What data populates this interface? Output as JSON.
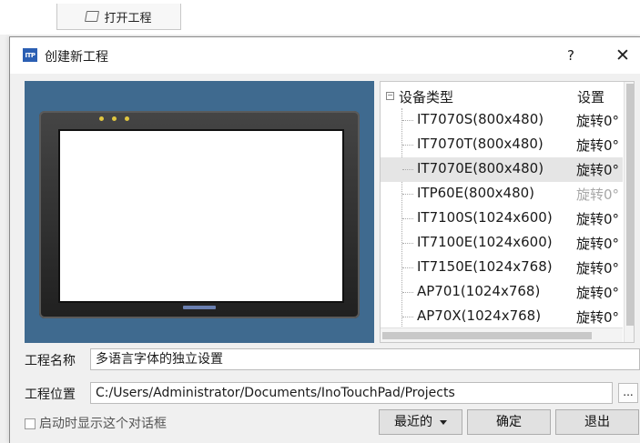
{
  "background_window": {
    "open_project_label": "打开工程"
  },
  "dialog": {
    "title": "创建新工程",
    "icon_text": "ITP",
    "help_label": "?",
    "close_label": "✕"
  },
  "device_table": {
    "header_type": "设备类型",
    "header_setting": "设置",
    "rows": [
      {
        "name": "IT7070S(800x480)",
        "setting": "旋转0°"
      },
      {
        "name": "IT7070T(800x480)",
        "setting": "旋转0°"
      },
      {
        "name": "IT7070E(800x480)",
        "setting": "旋转0°"
      },
      {
        "name": "ITP60E(800x480)",
        "setting": "旋转0°"
      },
      {
        "name": "IT7100S(1024x600)",
        "setting": "旋转0°"
      },
      {
        "name": "IT7100E(1024x600)",
        "setting": "旋转0°"
      },
      {
        "name": "IT7150E(1024x768)",
        "setting": "旋转0°"
      },
      {
        "name": "AP701(1024x768)",
        "setting": "旋转0°"
      },
      {
        "name": "AP70X(1024x768)",
        "setting": "旋转0°"
      }
    ],
    "selected_index": 2,
    "disabled_index": 3
  },
  "form": {
    "name_label": "工程名称",
    "name_value": "多语言字体的独立设置",
    "location_label": "工程位置",
    "location_value": "C:/Users/Administrator/Documents/InoTouchPad/Projects",
    "browse_label": "..."
  },
  "footer": {
    "show_on_start_label": "启动时显示这个对话框",
    "recent_label": "最近的",
    "ok_label": "确定",
    "exit_label": "退出"
  },
  "colors": {
    "preview_bg": "#3f6a8f",
    "selected_row": "#e5e5e5",
    "icon_blue": "#2b5fb3"
  }
}
